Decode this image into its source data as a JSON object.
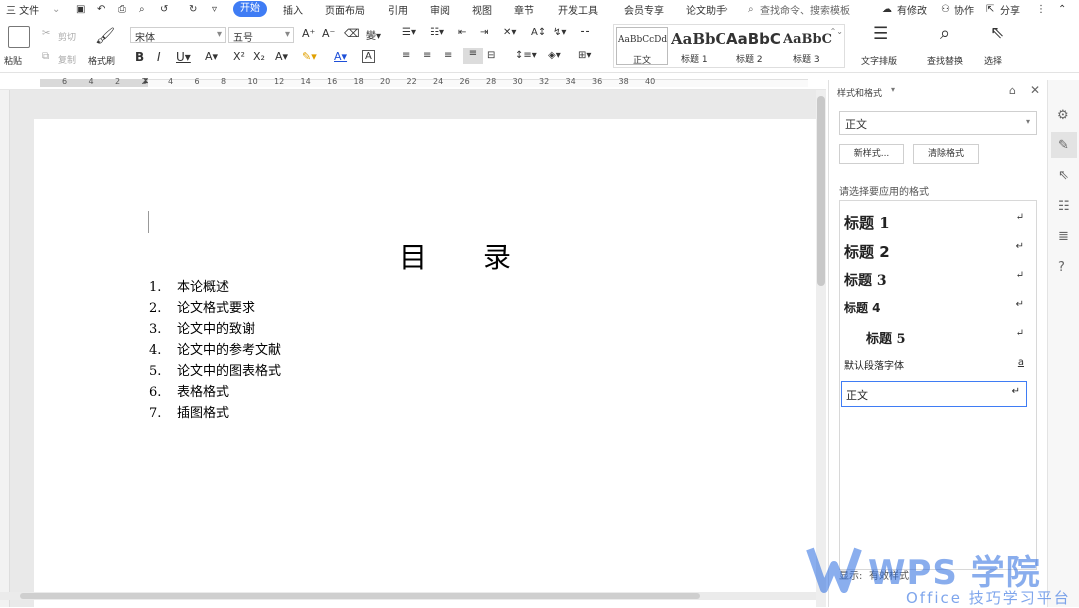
{
  "menubar": {
    "file": "三 文件",
    "tabs": [
      "开始",
      "插入",
      "页面布局",
      "引用",
      "审阅",
      "视图",
      "章节",
      "开发工具",
      "会员专享",
      "论文助手"
    ],
    "active_tab": "开始",
    "search": "查找命令、搜索模板",
    "right": [
      "有修改",
      "协作",
      "分享"
    ]
  },
  "ribbon": {
    "paste": "粘贴",
    "cut": "剪切",
    "copy": "复制",
    "format_painter": "格式刷",
    "font_name": "宋体",
    "font_size": "五号",
    "styles": [
      {
        "preview": "AaBbCcDd",
        "label": "正文"
      },
      {
        "preview": "AaBbC",
        "label": "标题 1"
      },
      {
        "preview": "AaBbC",
        "label": "标题 2"
      },
      {
        "preview": "AaBbC",
        "label": "标题 3"
      }
    ],
    "text_layout": "文字排版",
    "find_replace": "查找替换",
    "select": "选择"
  },
  "ruler": {
    "numbers": [
      "6",
      "4",
      "2",
      "2",
      "4",
      "6",
      "8",
      "10",
      "12",
      "14",
      "16",
      "18",
      "20",
      "22",
      "24",
      "26",
      "28",
      "30",
      "32",
      "34",
      "36",
      "38",
      "40"
    ]
  },
  "document": {
    "title": "目　　录",
    "items": [
      {
        "num": "1.",
        "text": "本论概述"
      },
      {
        "num": "2.",
        "text": "论文格式要求"
      },
      {
        "num": "3.",
        "text": "论文中的致谢"
      },
      {
        "num": "4.",
        "text": "论文中的参考文献"
      },
      {
        "num": "5.",
        "text": "论文中的图表格式"
      },
      {
        "num": "6.",
        "text": "表格格式"
      },
      {
        "num": "7.",
        "text": "插图格式"
      }
    ]
  },
  "panel": {
    "title": "样式和格式",
    "current_style": "正文",
    "new_style": "新样式...",
    "clear_format": "清除格式",
    "prompt": "请选择要应用的格式",
    "styles": [
      {
        "name": "标题  1",
        "ret": "↵"
      },
      {
        "name": "标题  2",
        "ret": "↵"
      },
      {
        "name": "标题  3",
        "ret": "↵"
      },
      {
        "name": "标题  4",
        "ret": "↵"
      },
      {
        "name": "标题  5",
        "ret": "↵"
      },
      {
        "name": "默认段落字体",
        "ret": "a"
      },
      {
        "name": "正文",
        "ret": "↵"
      }
    ],
    "show_label": "显示:",
    "show_value": "有效样式"
  },
  "watermark": {
    "brand": "WPS 学院",
    "tagline": "Office 技巧学习平台"
  },
  "colors": {
    "accent": "#3f7cf4",
    "watermark": "#2a6be0"
  }
}
